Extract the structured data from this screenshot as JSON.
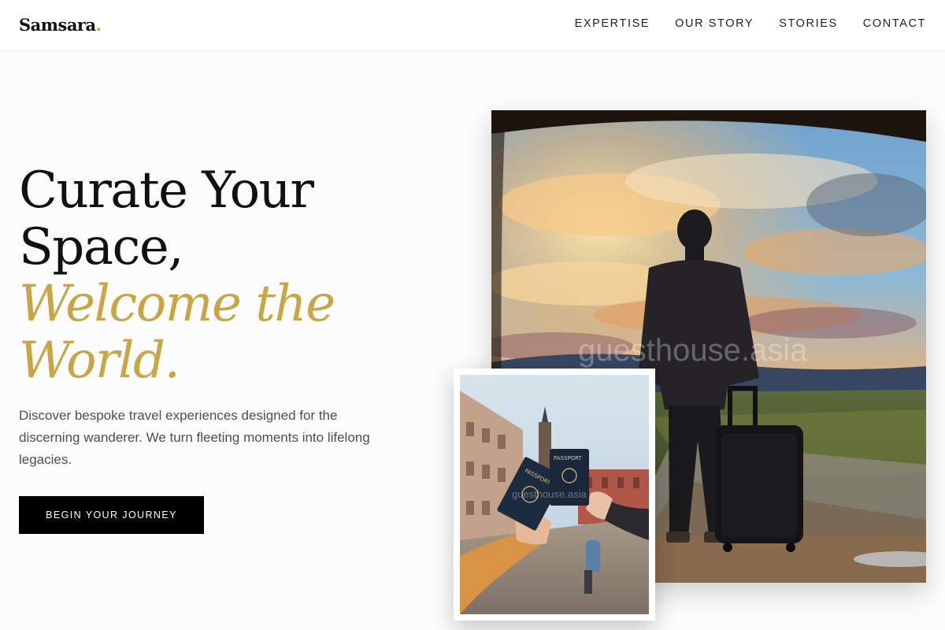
{
  "header": {
    "brand_name": "Samsara",
    "brand_dot": ".",
    "nav": [
      {
        "label": "EXPERTISE"
      },
      {
        "label": "OUR STORY"
      },
      {
        "label": "STORIES"
      },
      {
        "label": "CONTACT"
      }
    ]
  },
  "hero": {
    "title_line1": "Curate Your",
    "title_line2": "Space,",
    "title_accent_line1": "Welcome the",
    "title_accent_line2": "World.",
    "description": "Discover bespoke travel experiences designed for the discerning wanderer. We turn fleeting moments into lifelong legacies.",
    "cta_label": "BEGIN YOUR JOURNEY"
  },
  "images": {
    "main_watermark": "guesthouse.asia",
    "inset_watermark": "guesthouse.asia",
    "passport_label": "PASSPORT"
  },
  "colors": {
    "accent_gold": "#c9a643",
    "cta_background": "#000000",
    "text_dark": "#111111",
    "text_body": "#4a4f57"
  }
}
